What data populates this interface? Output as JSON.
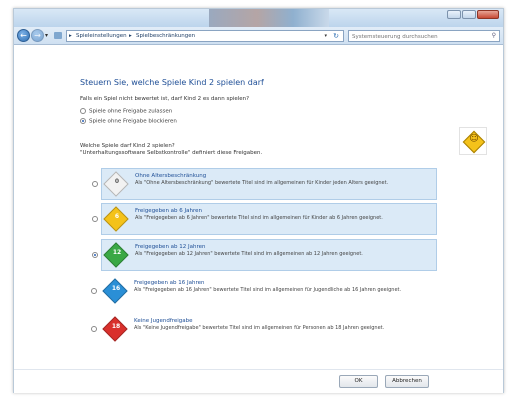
{
  "addressbar": {
    "crumbs": [
      "Spieleinstellungen",
      "Spielbeschränkungen"
    ],
    "search_placeholder": "Systemsteuerung durchsuchen"
  },
  "main": {
    "heading": "Steuern Sie, welche Spiele Kind 2 spielen darf",
    "question": "Falls ein Spiel nicht bewertet ist, darf Kind 2 es dann spielen?",
    "unrated_options": [
      {
        "label": "Spiele ohne Freigabe zulassen",
        "selected": false
      },
      {
        "label": "Spiele ohne Freigabe blockieren",
        "selected": true
      }
    ],
    "ratings_question": "Welche Spiele darf Kind 2 spielen?",
    "ratings_note": "\"Unterhaltungssoftware Selbstkontrolle\" definiert diese Freigaben.",
    "ratings": [
      {
        "title": "Ohne Altersbeschränkung",
        "desc": "Als \"Ohne Altersbeschränkung\" bewertete Titel sind im allgemeinen für Kinder jeden Alters geeignet.",
        "color": "#f2f2f2",
        "num": "0",
        "selected": false,
        "highlighted": true
      },
      {
        "title": "Freigegeben ab 6 Jahren",
        "desc": "Als \"Freigegeben ab 6 Jahren\" bewertete Titel sind im allgemeinen für Kinder ab 6 Jahren geeignet.",
        "color": "#f4c21a",
        "num": "6",
        "selected": false,
        "highlighted": true
      },
      {
        "title": "Freigegeben ab 12 Jahren",
        "desc": "Als \"Freigegeben ab 12 Jahren\" bewertete Titel sind im allgemeinen ab 12 Jahren geeignet.",
        "color": "#3aa845",
        "num": "12",
        "selected": true,
        "highlighted": true
      },
      {
        "title": "Freigegeben ab 16 Jahren",
        "desc": "Als \"Freigegeben ab 16 Jahren\" bewertete Titel sind im allgemeinen für Jugendliche ab 16 Jahren geeignet.",
        "color": "#2a8fd6",
        "num": "16",
        "selected": false,
        "highlighted": false
      },
      {
        "title": "Keine Jugendfreigabe",
        "desc": "Als \"Keine Jugendfreigabe\" bewertete Titel sind im allgemeinen für Personen ab 18 Jahren geeignet.",
        "color": "#d9302c",
        "num": "18",
        "selected": false,
        "highlighted": false
      }
    ]
  },
  "footer": {
    "ok_label": "OK",
    "cancel_label": "Abbrechen"
  }
}
